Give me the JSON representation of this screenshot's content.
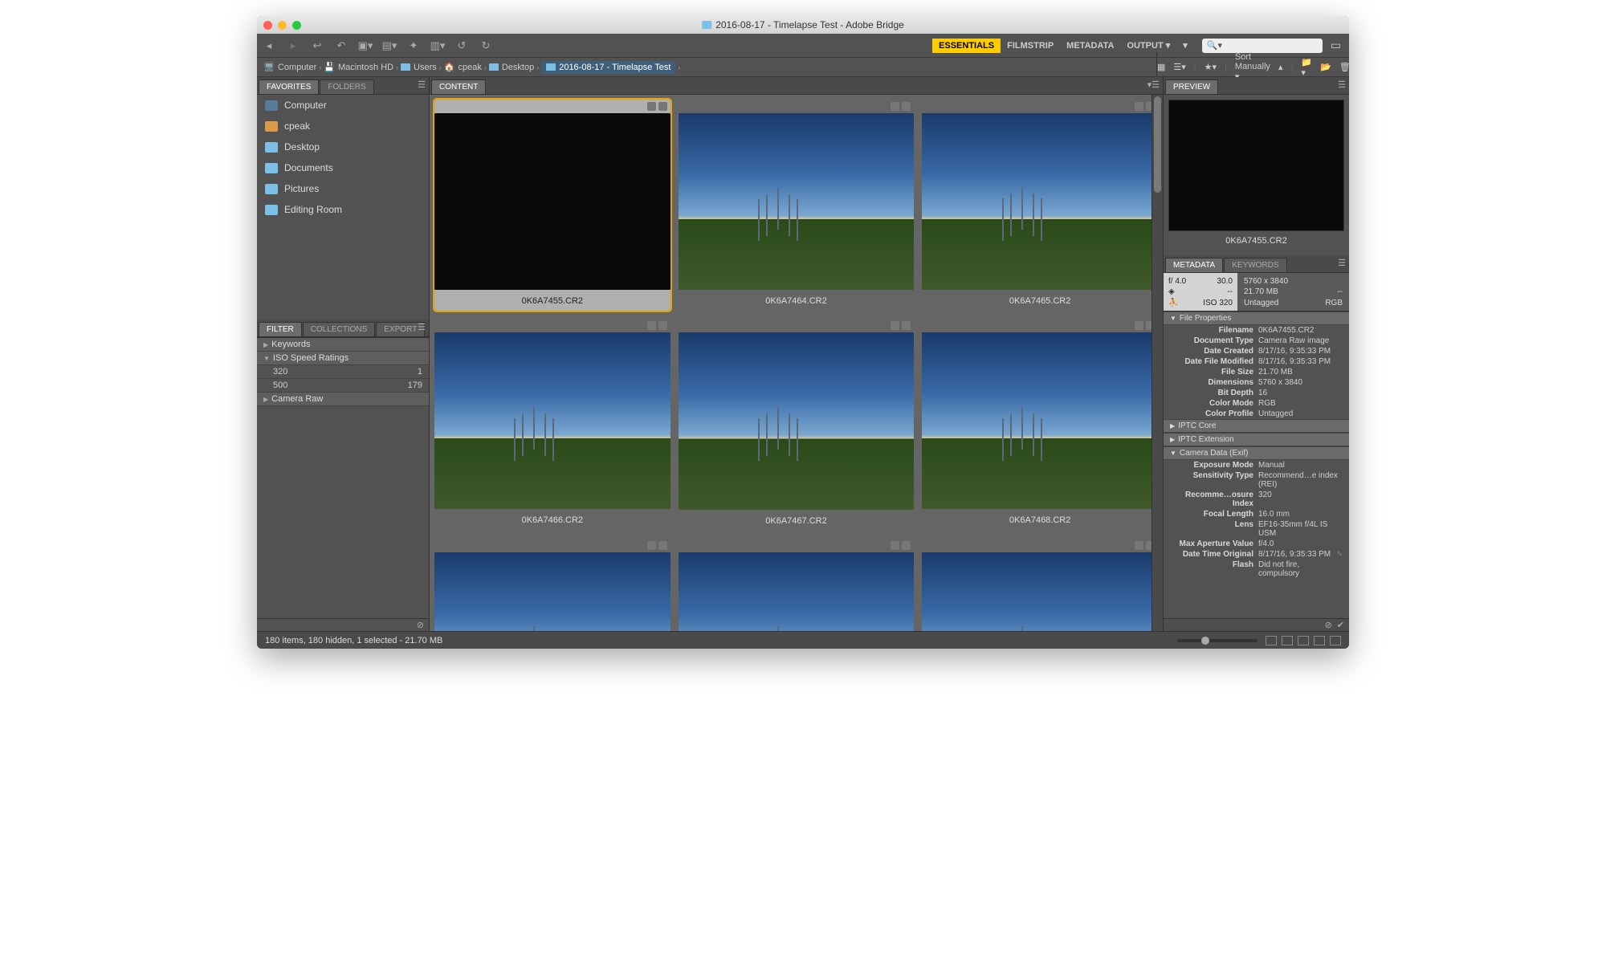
{
  "title": "2016-08-17 - Timelapse Test - Adobe Bridge",
  "workspaces": {
    "essentials": "ESSENTIALS",
    "filmstrip": "FILMSTRIP",
    "metadata": "METADATA",
    "output": "OUTPUT ▾"
  },
  "search_placeholder": "",
  "breadcrumbs": [
    "Computer",
    "Macintosh HD",
    "Users",
    "cpeak",
    "Desktop",
    "2016-08-17 - Timelapse Test"
  ],
  "sort_label": "Sort Manually ▾",
  "favorites_tab": "FAVORITES",
  "folders_tab": "FOLDERS",
  "favorites": [
    "Computer",
    "cpeak",
    "Desktop",
    "Documents",
    "Pictures",
    "Editing Room"
  ],
  "filter_tabs": {
    "filter": "FILTER",
    "collections": "COLLECTIONS",
    "export": "EXPORT"
  },
  "filter": {
    "keywords": "Keywords",
    "iso_label": "ISO Speed Ratings",
    "iso": [
      {
        "val": "320",
        "count": "1"
      },
      {
        "val": "500",
        "count": "179"
      }
    ],
    "camera_raw": "Camera Raw"
  },
  "content_tab": "CONTENT",
  "thumbnails": [
    {
      "name": "0K6A7455.CR2",
      "black": true,
      "selected": true
    },
    {
      "name": "0K6A7464.CR2"
    },
    {
      "name": "0K6A7465.CR2"
    },
    {
      "name": "0K6A7466.CR2"
    },
    {
      "name": "0K6A7467.CR2"
    },
    {
      "name": "0K6A7468.CR2"
    },
    {
      "name": ""
    },
    {
      "name": ""
    },
    {
      "name": ""
    }
  ],
  "preview_tab": "PREVIEW",
  "preview_name": "0K6A7455.CR2",
  "meta_tabs": {
    "metadata": "METADATA",
    "keywords": "KEYWORDS"
  },
  "meta_summary": {
    "aperture": "f/ 4.0",
    "shutter": "30.0",
    "awb": "--",
    "iso_lbl": "ISO",
    "iso": "320",
    "dims": "5760 x 3840",
    "size": "21.70 MB",
    "dash": "--",
    "tag": "Untagged",
    "cs": "RGB"
  },
  "sections": {
    "file_props": "File Properties",
    "iptc_core": "IPTC Core",
    "iptc_ext": "IPTC Extension",
    "camera_data": "Camera Data (Exif)"
  },
  "file_props": [
    {
      "k": "Filename",
      "v": "0K6A7455.CR2"
    },
    {
      "k": "Document Type",
      "v": "Camera Raw image"
    },
    {
      "k": "Date Created",
      "v": "8/17/16, 9:35:33 PM"
    },
    {
      "k": "Date File Modified",
      "v": "8/17/16, 9:35:33 PM"
    },
    {
      "k": "File Size",
      "v": "21.70 MB"
    },
    {
      "k": "Dimensions",
      "v": "5760 x 3840"
    },
    {
      "k": "Bit Depth",
      "v": "16"
    },
    {
      "k": "Color Mode",
      "v": "RGB"
    },
    {
      "k": "Color Profile",
      "v": "Untagged"
    }
  ],
  "camera_data": [
    {
      "k": "Exposure Mode",
      "v": "Manual"
    },
    {
      "k": "Sensitivity Type",
      "v": "Recommend…e index (REI)"
    },
    {
      "k": "Recomme…osure Index",
      "v": "320"
    },
    {
      "k": "Focal Length",
      "v": "16.0 mm"
    },
    {
      "k": "Lens",
      "v": "EF16-35mm f/4L IS USM"
    },
    {
      "k": "Max Aperture Value",
      "v": "f/4.0"
    },
    {
      "k": "Date Time Original",
      "v": "8/17/16, 9:35:33 PM",
      "pencil": true
    },
    {
      "k": "Flash",
      "v": "Did not fire, compulsory"
    }
  ],
  "status": "180 items, 180 hidden, 1 selected - 21.70 MB"
}
